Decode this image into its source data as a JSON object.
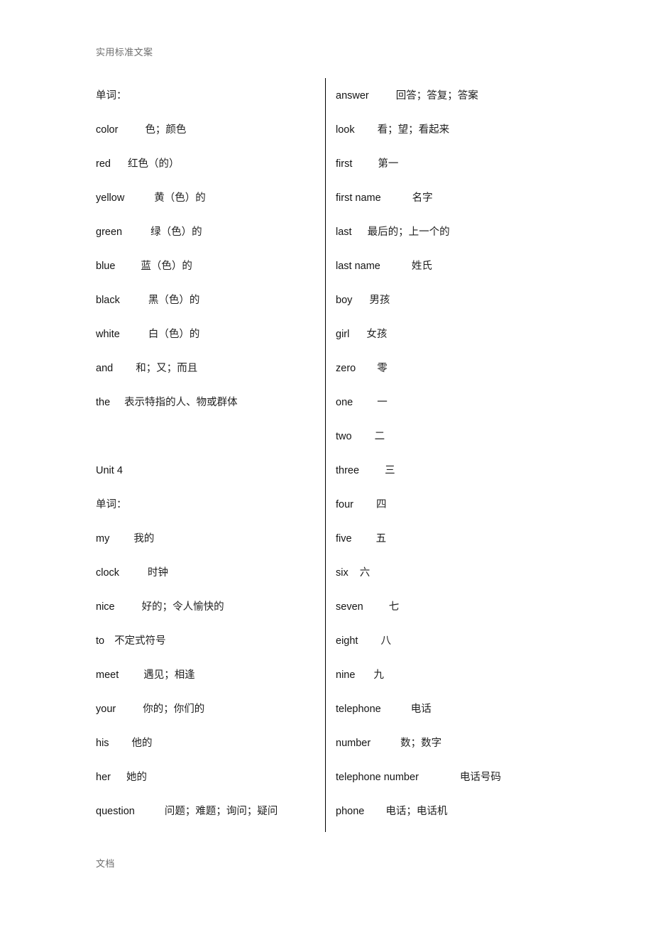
{
  "header": {
    "text": "实用标准文案"
  },
  "footer": {
    "text": "文档"
  },
  "left_column": {
    "entries": [
      {
        "kind": "label",
        "term": "单词：",
        "gloss": "",
        "gap": 0
      },
      {
        "kind": "word",
        "term": "color",
        "gloss": "色；颜色",
        "gap": 38
      },
      {
        "kind": "word",
        "term": "red",
        "gloss": "红色（的）",
        "gap": 24
      },
      {
        "kind": "word",
        "term": "yellow",
        "gloss": "黄（色）的",
        "gap": 42
      },
      {
        "kind": "word",
        "term": "green",
        "gloss": "绿（色）的",
        "gap": 40
      },
      {
        "kind": "word",
        "term": "blue",
        "gloss": "蓝（色）的",
        "gap": 36
      },
      {
        "kind": "word",
        "term": "black",
        "gloss": "黑（色）的",
        "gap": 40
      },
      {
        "kind": "word",
        "term": "white",
        "gloss": "白（色）的",
        "gap": 40
      },
      {
        "kind": "word",
        "term": "and",
        "gloss": "和；又；而且",
        "gap": 32
      },
      {
        "kind": "word",
        "term": "the",
        "gloss": "表示特指的人、物或群体",
        "gap": 20
      },
      {
        "kind": "spacer",
        "term": "",
        "gloss": "",
        "gap": 0
      },
      {
        "kind": "heading",
        "term": "Unit 4",
        "gloss": "",
        "gap": 0
      },
      {
        "kind": "label",
        "term": "单词：",
        "gloss": "",
        "gap": 0
      },
      {
        "kind": "word",
        "term": "my",
        "gloss": "我的",
        "gap": 34
      },
      {
        "kind": "word",
        "term": "clock",
        "gloss": "时钟",
        "gap": 40
      },
      {
        "kind": "word",
        "term": "nice",
        "gloss": "好的；令人愉快的",
        "gap": 38
      },
      {
        "kind": "word",
        "term": "to",
        "gloss": "不定式符号",
        "gap": 14
      },
      {
        "kind": "word",
        "term": "meet",
        "gloss": "遇见；相逢",
        "gap": 35
      },
      {
        "kind": "word",
        "term": "your",
        "gloss": "你的；你们的",
        "gap": 38
      },
      {
        "kind": "word",
        "term": "his",
        "gloss": "他的",
        "gap": 32
      },
      {
        "kind": "word",
        "term": "her",
        "gloss": "她的",
        "gap": 22
      },
      {
        "kind": "word",
        "term": "question",
        "gloss": "问题；难题；询问；疑问",
        "gap": 42
      }
    ]
  },
  "right_column": {
    "entries": [
      {
        "kind": "word",
        "term": "answer",
        "gloss": "回答；答复；答案",
        "gap": 38
      },
      {
        "kind": "word",
        "term": "look",
        "gloss": "看；望；看起来",
        "gap": 32
      },
      {
        "kind": "word",
        "term": "first",
        "gloss": "第一",
        "gap": 36
      },
      {
        "kind": "word",
        "term": "first name",
        "gloss": "名字",
        "gap": 44
      },
      {
        "kind": "word",
        "term": "last",
        "gloss": "最后的；上一个的",
        "gap": 22
      },
      {
        "kind": "word",
        "term": "last name",
        "gloss": "姓氏",
        "gap": 44
      },
      {
        "kind": "word",
        "term": "boy",
        "gloss": "男孩",
        "gap": 24
      },
      {
        "kind": "word",
        "term": "girl",
        "gloss": "女孩",
        "gap": 24
      },
      {
        "kind": "word",
        "term": "zero",
        "gloss": "零",
        "gap": 30
      },
      {
        "kind": "word",
        "term": "one",
        "gloss": "一",
        "gap": 34
      },
      {
        "kind": "word",
        "term": "two",
        "gloss": "二",
        "gap": 32
      },
      {
        "kind": "word",
        "term": "three",
        "gloss": "三",
        "gap": 36
      },
      {
        "kind": "word",
        "term": "four",
        "gloss": "四",
        "gap": 32
      },
      {
        "kind": "word",
        "term": "five",
        "gloss": "五",
        "gap": 34
      },
      {
        "kind": "word",
        "term": "six",
        "gloss": "六",
        "gap": 16
      },
      {
        "kind": "word",
        "term": "seven",
        "gloss": "七",
        "gap": 36
      },
      {
        "kind": "word",
        "term": "eight",
        "gloss": "八",
        "gap": 32
      },
      {
        "kind": "word",
        "term": "nine",
        "gloss": "九",
        "gap": 26
      },
      {
        "kind": "word",
        "term": "telephone",
        "gloss": "电话",
        "gap": 42
      },
      {
        "kind": "word",
        "term": "number",
        "gloss": "数；数字",
        "gap": 42
      },
      {
        "kind": "word",
        "term": "telephone number",
        "gloss": "电话号码",
        "gap": 58
      },
      {
        "kind": "word",
        "term": "phone",
        "gloss": "电话；电话机",
        "gap": 30
      }
    ]
  }
}
